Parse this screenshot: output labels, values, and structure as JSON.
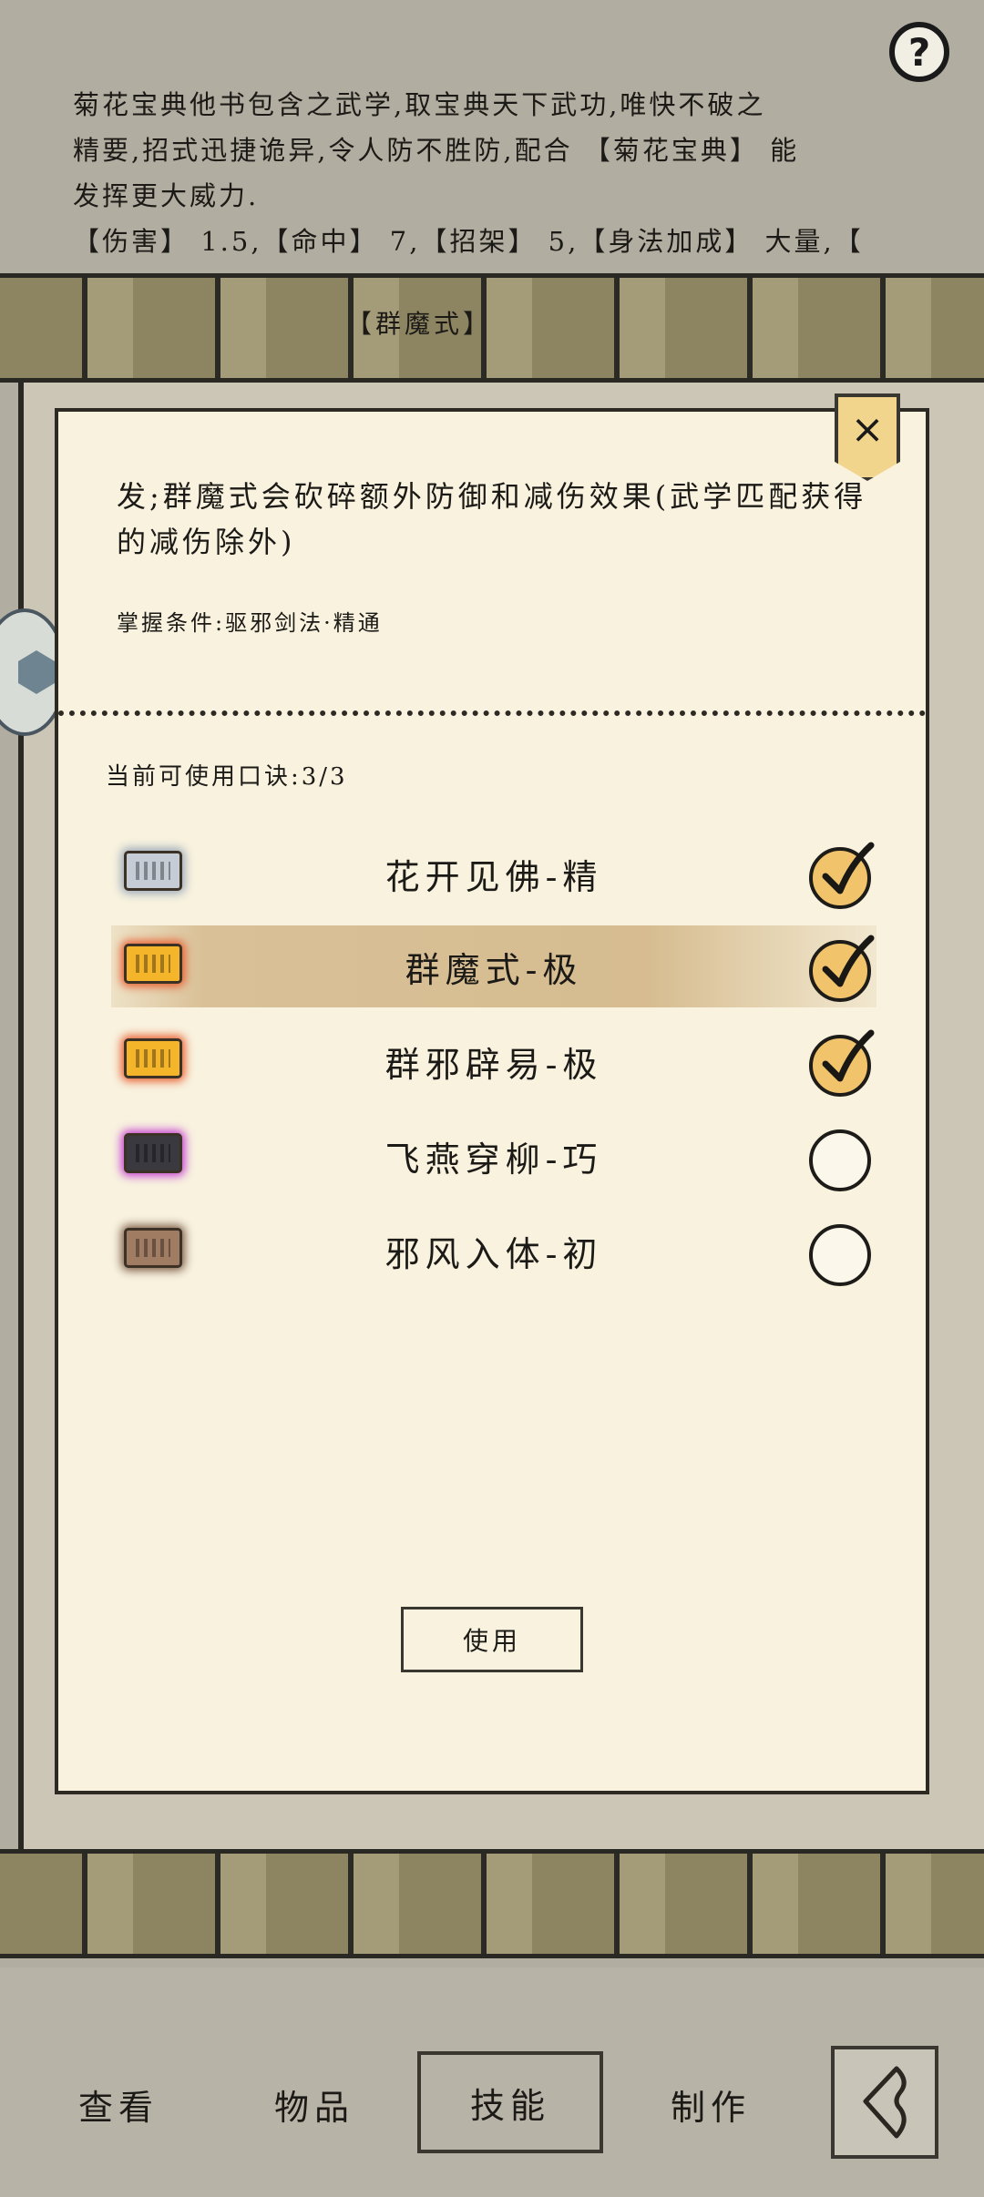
{
  "background": {
    "description_lines": [
      "菊花宝典他书包含之武学,取宝典天下武功,唯快不破之",
      "精要,招式迅捷诡异,令人防不胜防,配合 【菊花宝典】 能",
      "发挥更大威力.",
      "【伤害】 1.5,【命中】 7,【招架】 5,【身法加成】 大量,【"
    ],
    "tag": "【群魔式】"
  },
  "help_label": "?",
  "dialog": {
    "close_label": "×",
    "effect_text": "发;群魔式会砍碎额外防御和减伤效果(武学匹配获得的减伤除外)",
    "requirement": "掌握条件:驱邪剑法·精通",
    "mantra_count": "当前可使用口诀:3/3",
    "mantras": [
      {
        "name": "花开见佛-精",
        "tile_color": "#c5ccd6",
        "glow": "#9aa7b8",
        "checked": true,
        "selected": false
      },
      {
        "name": "群魔式-极",
        "tile_color": "#f4b52a",
        "glow": "#e85a2a",
        "checked": true,
        "selected": true
      },
      {
        "name": "群邪辟易-极",
        "tile_color": "#f4b52a",
        "glow": "#e85a2a",
        "checked": true,
        "selected": false
      },
      {
        "name": "飞燕穿柳-巧",
        "tile_color": "#3b3940",
        "glow": "#c43ad1",
        "checked": false,
        "selected": false
      },
      {
        "name": "邪风入体-初",
        "tile_color": "#a07c62",
        "glow": "#7a5a44",
        "checked": false,
        "selected": false
      }
    ],
    "use_label": "使用"
  },
  "nav": {
    "view": "查看",
    "items": "物品",
    "skills": "技能",
    "craft": "制作"
  }
}
